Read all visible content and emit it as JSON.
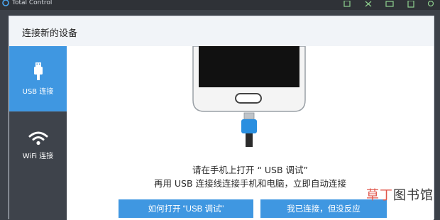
{
  "app": {
    "title": "Total Control"
  },
  "topbar": {
    "icons": [
      "screenshot-icon",
      "fullscreen-icon",
      "folder-icon",
      "clipboard-icon",
      "settings-icon"
    ]
  },
  "dialog": {
    "title": "连接新的设备"
  },
  "sidebar": {
    "items": [
      {
        "label": "USB 连接",
        "icon": "usb-icon",
        "active": true
      },
      {
        "label": "WiFi 连接",
        "icon": "wifi-icon",
        "active": false
      }
    ]
  },
  "main": {
    "instruction_line1": "请在手机上打开 “ USB 调试”",
    "instruction_line2": "再用 USB 连接线连接手机和电脑，立即自动连接",
    "buttons": {
      "how_to_enable": "如何打开 “USB 调试”",
      "connected_no_response": "我已连接，但没反应"
    }
  },
  "watermark": {
    "part1": "草丁",
    "part2": "图书馆"
  },
  "colors": {
    "accent": "#3f97e1",
    "sidebar_bg": "#3e434b",
    "header_bg": "#f1f4f8",
    "topbar_bg": "#2f3237"
  }
}
